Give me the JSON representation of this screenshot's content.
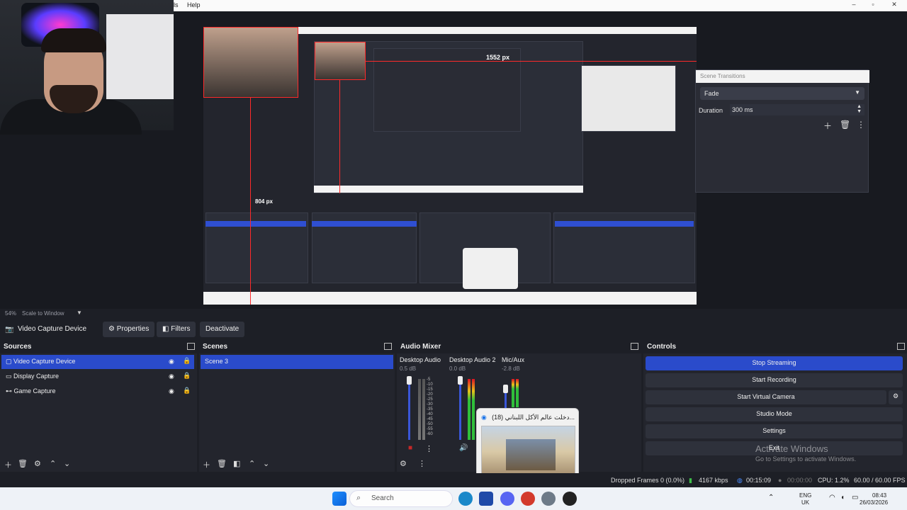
{
  "menu": {
    "help": "Help",
    "ls": "ls"
  },
  "window_buttons": {
    "minimize": "–",
    "maximize": "▫",
    "close": "✕"
  },
  "preview": {
    "px_label_1": "1552 px",
    "px_label_2": "804 px"
  },
  "transitions": {
    "title": "Scene Transitions",
    "selected": "Fade",
    "duration_label": "Duration",
    "duration_value": "300 ms"
  },
  "zoom": {
    "percent": "54%",
    "mode": "Scale to Window"
  },
  "context": {
    "source_name": "Video Capture Device",
    "properties": "Properties",
    "filters": "Filters",
    "deactivate": "Deactivate"
  },
  "sources": {
    "title": "Sources",
    "items": [
      {
        "label": "Video Capture Device",
        "icon": "camera-icon"
      },
      {
        "label": "Display Capture",
        "icon": "monitor-icon"
      },
      {
        "label": "Game Capture",
        "icon": "gamepad-icon"
      }
    ]
  },
  "scenes": {
    "title": "Scenes",
    "items": [
      "Scene 3"
    ]
  },
  "mixer": {
    "title": "Audio Mixer",
    "channels": [
      {
        "name": "Desktop Audio",
        "db": "0.5 dB"
      },
      {
        "name": "Desktop Audio 2",
        "db": "0.0 dB"
      },
      {
        "name": "Mic/Aux",
        "db": "-2.8 dB"
      }
    ],
    "scale": [
      "-5",
      "-10",
      "-15",
      "-20",
      "-25",
      "-30",
      "-35",
      "-40",
      "-45",
      "-50",
      "-55",
      "-60"
    ]
  },
  "controls": {
    "title": "Controls",
    "stop_streaming": "Stop Streaming",
    "start_recording": "Start Recording",
    "start_virtual_camera": "Start Virtual Camera",
    "studio_mode": "Studio Mode",
    "settings": "Settings",
    "exit": "Exit"
  },
  "popup": {
    "title": "(18) دخلت عالم الأكل اللبناني..."
  },
  "watermark": {
    "line1": "Activate Windows",
    "line2": "Go to Settings to activate Windows."
  },
  "status": {
    "dropped": "Dropped Frames 0 (0.0%)",
    "kbps": "4167 kbps",
    "stream_time": "00:15:09",
    "rec_time": "00:00:00",
    "cpu": "CPU: 1.2%",
    "fps": "60.00 / 60.00 FPS"
  },
  "taskbar": {
    "search": "Search",
    "lang1": "ENG",
    "lang2": "UK",
    "time": "08:43",
    "date": "26/03/2026"
  },
  "colors": {
    "accent": "#2a4bcb",
    "panel": "#23252d",
    "bg": "#1d1f26"
  }
}
